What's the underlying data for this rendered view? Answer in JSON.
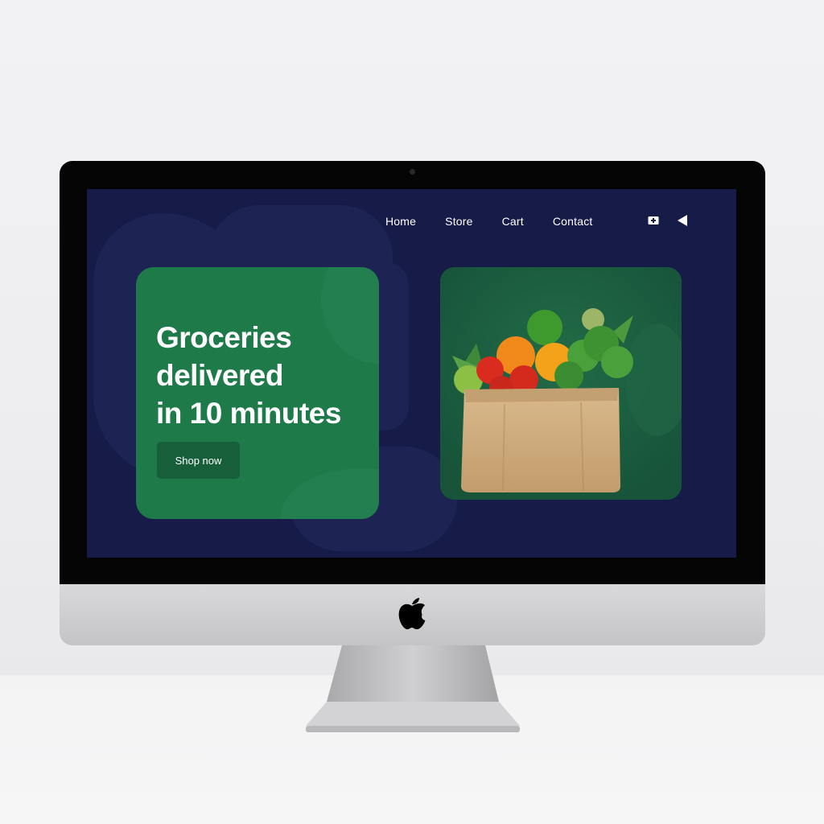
{
  "nav": {
    "items": [
      {
        "label": "Home"
      },
      {
        "label": "Store"
      },
      {
        "label": "Cart"
      },
      {
        "label": "Contact"
      }
    ]
  },
  "nav_icons": {
    "first": "add-box-icon",
    "second": "back-triangle-icon"
  },
  "hero": {
    "title_line1": "Groceries",
    "title_line2": "delivered",
    "title_line3": "in 10 minutes",
    "cta_label": "Shop now"
  },
  "product_image": {
    "icon": "grocery-bag-image"
  },
  "colors": {
    "screen_bg": "#171b48",
    "hero_green": "#1f7a4a",
    "button_green": "#175e3b",
    "image_card_green": "#1c5d3e"
  }
}
